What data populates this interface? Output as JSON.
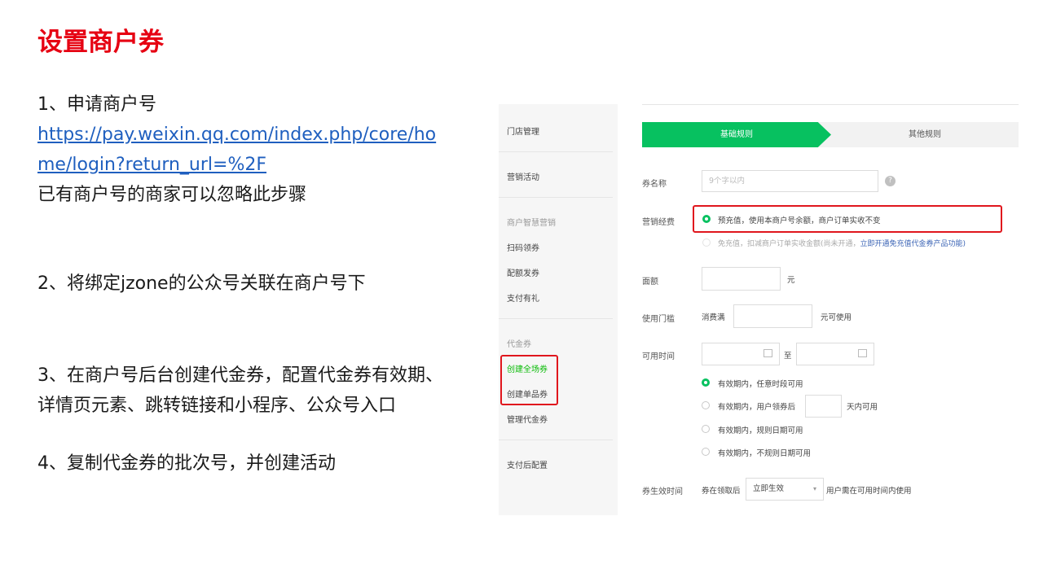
{
  "slide": {
    "title": "设置商户券",
    "step1_title": "1、申请商户号",
    "step1_url_line1": "https://pay.weixin.qq.com/index.php/core/ho",
    "step1_url_line2": "me/login?return_url=%2F",
    "step1_note": "已有商户号的商家可以忽略此步骤",
    "step2": "2、将绑定jzone的公众号关联在商户号下",
    "step3_line1": "3、在商户号后台创建代金券，配置代金券有效期、",
    "step3_line2": "详情页元素、跳转链接和小程序、公众号入口",
    "step4": "4、复制代金券的批次号，并创建活动"
  },
  "screenshot": {
    "sidebar": {
      "store_mgmt": "门店管理",
      "marketing": "营销活动",
      "smart_marketing": "商户智慧营销",
      "scan_coupon": "扫码领券",
      "quota_issue": "配额发券",
      "pay_gift": "支付有礼",
      "voucher": "代金券",
      "create_all": "创建全场券",
      "create_single": "创建单品券",
      "manage_voucher": "管理代金券",
      "post_pay": "支付后配置"
    },
    "tabs": {
      "basic": "基础规则",
      "other": "其他规则"
    },
    "form": {
      "name_label": "券名称",
      "name_placeholder": "9个字以内",
      "fee_label": "营销经费",
      "fee_option1": "预充值，使用本商户号余额，商户订单实收不变",
      "fee_option2": "免充值，扣减商户订单实收金额(尚未开通，",
      "fee_option2_link": "立即开通免充值代金券产品功能)",
      "amount_label": "面额",
      "amount_unit": "元",
      "threshold_label": "使用门槛",
      "threshold_prefix": "消费满",
      "threshold_suffix": "元可使用",
      "time_label": "可用时间",
      "time_to": "至",
      "time_opt1": "有效期内，任意时段可用",
      "time_opt2_a": "有效期内，用户领券后",
      "time_opt2_b": "天内可用",
      "time_opt3": "有效期内，规则日期可用",
      "time_opt4": "有效期内，不规则日期可用",
      "effect_label": "券生效时间",
      "effect_prefix": "券在领取后",
      "effect_select": "立即生效",
      "effect_suffix": "用户需在可用时间内使用"
    }
  }
}
